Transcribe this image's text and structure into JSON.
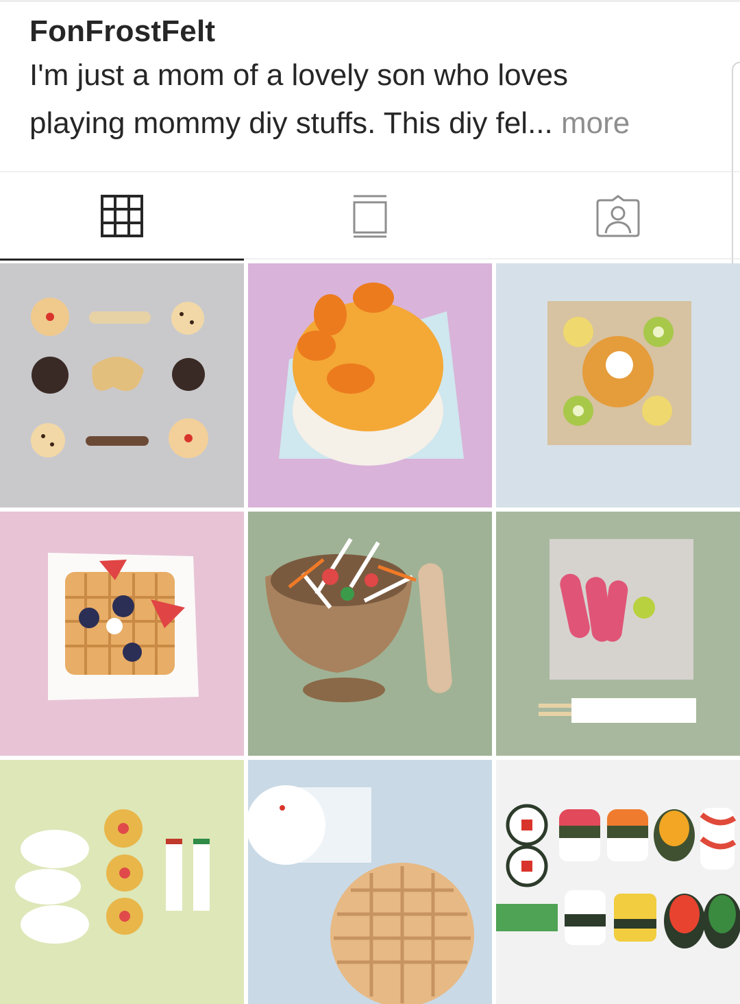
{
  "profile": {
    "username": "FonFrostFelt",
    "bio_line1": "I'm just a mom of a lovely son who loves",
    "bio_line2": "playing mommy diy stuffs. This diy fel...",
    "more_label": "more"
  },
  "tabs": [
    {
      "icon": "grid-icon",
      "active": true
    },
    {
      "icon": "feed-icon",
      "active": false
    },
    {
      "icon": "tagged-icon",
      "active": false
    }
  ],
  "posts": [
    {
      "subject": "felt cookies and pretzel",
      "background": "#c9c9cc"
    },
    {
      "subject": "felt orange cake",
      "background": "#d9b3d9"
    },
    {
      "subject": "felt pancake with fruit",
      "background": "#d6e0e8"
    },
    {
      "subject": "felt waffle with berries",
      "background": "#e8c3d6"
    },
    {
      "subject": "felt papaya salad mortar",
      "background": "#9fb295"
    },
    {
      "subject": "felt crab sticks",
      "background": "#a8b89e"
    },
    {
      "subject": "felt dumplings and rolls",
      "background": "#dde7b8"
    },
    {
      "subject": "felt bun and steamer",
      "background": "#c9d9e6"
    },
    {
      "subject": "felt sushi",
      "background": "#f2f2f2"
    }
  ]
}
